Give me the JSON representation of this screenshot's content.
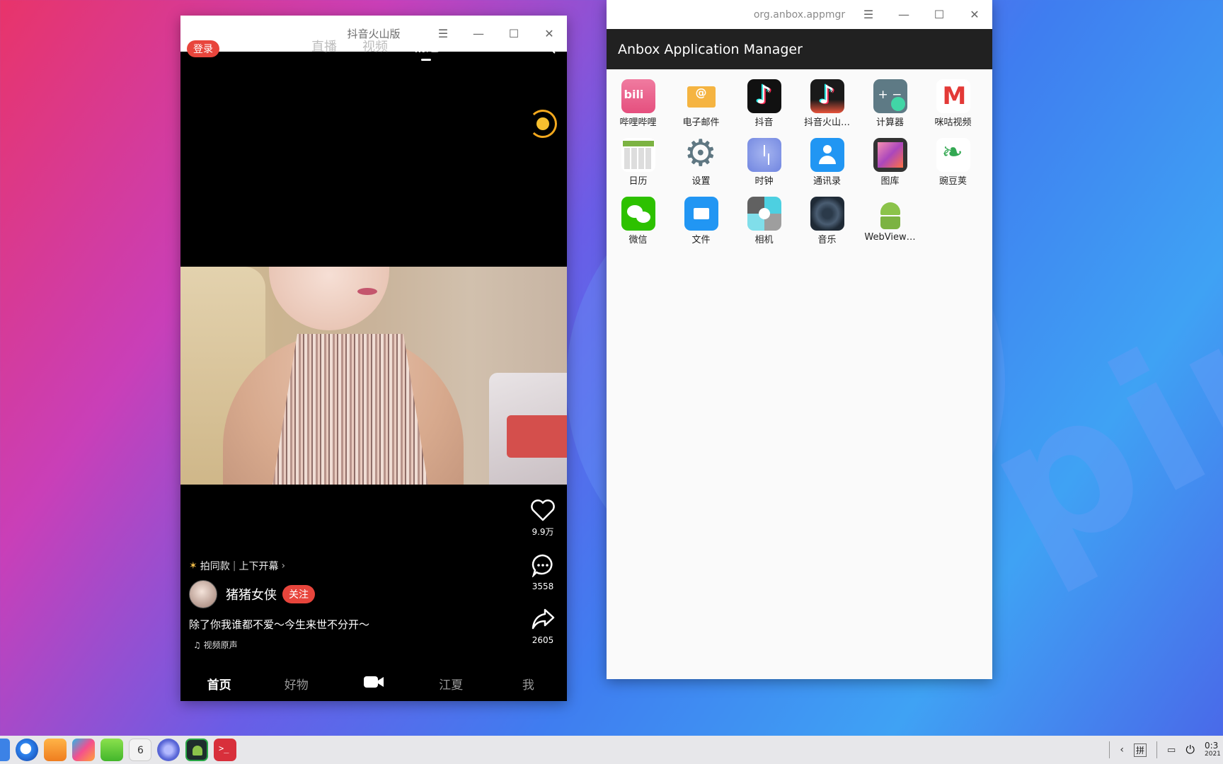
{
  "douyin_window": {
    "title": "抖音火山版",
    "controls": {
      "menu": "☰",
      "minimize": "—",
      "maximize": "☐",
      "close": "✕"
    },
    "login_label": "登录",
    "nav_tabs": [
      {
        "label": "直播"
      },
      {
        "label": "视频"
      },
      {
        "label": "精选"
      }
    ],
    "actions": {
      "like_count": "9.9万",
      "comment_count": "3558",
      "share_count": "2605"
    },
    "pai_label": "拍同款",
    "pai_effect": "上下开幕",
    "pai_chevron": "›",
    "author_name": "猪猪女侠",
    "follow_label": "关注",
    "caption": "除了你我谁都不爱～今生来世不分开～",
    "music_label": "视频原声",
    "bottom_nav": [
      {
        "label": "首页"
      },
      {
        "label": "好物"
      },
      {
        "label": "江夏"
      },
      {
        "label": "我"
      }
    ]
  },
  "anbox_window": {
    "title": "org.anbox.appmgr",
    "controls": {
      "menu": "☰",
      "minimize": "—",
      "maximize": "☐",
      "close": "✕"
    },
    "header": "Anbox Application Manager",
    "apps": [
      {
        "label": "哔哩哔哩",
        "icon": "bilibili-icon"
      },
      {
        "label": "电子邮件",
        "icon": "email-icon"
      },
      {
        "label": "抖音",
        "icon": "tiktok-icon"
      },
      {
        "label": "抖音火山…",
        "icon": "tiktok-volcano-icon"
      },
      {
        "label": "计算器",
        "icon": "calculator-icon"
      },
      {
        "label": "咪咕视频",
        "icon": "migu-video-icon"
      },
      {
        "label": "日历",
        "icon": "calendar-icon"
      },
      {
        "label": "设置",
        "icon": "settings-icon"
      },
      {
        "label": "时钟",
        "icon": "clock-icon"
      },
      {
        "label": "通讯录",
        "icon": "contacts-icon"
      },
      {
        "label": "图库",
        "icon": "gallery-icon"
      },
      {
        "label": "豌豆荚",
        "icon": "wandoujia-icon"
      },
      {
        "label": "微信",
        "icon": "wechat-icon"
      },
      {
        "label": "文件",
        "icon": "files-icon"
      },
      {
        "label": "相机",
        "icon": "camera-icon"
      },
      {
        "label": "音乐",
        "icon": "music-icon"
      },
      {
        "label": "WebView…",
        "icon": "webview-icon"
      }
    ]
  },
  "taskbar": {
    "ime_label": "拼",
    "clock_time": "0:3",
    "clock_date": "2021/"
  }
}
